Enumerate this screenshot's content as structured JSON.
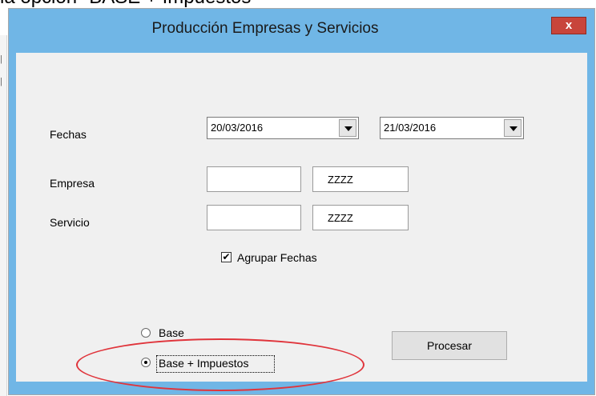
{
  "header": {
    "caption": "la opción \"BASE + Impuestos\""
  },
  "window": {
    "title": "Producción Empresas y Servicios",
    "close_label": "x"
  },
  "form": {
    "fechas_label": "Fechas",
    "fecha_desde": "20/03/2016",
    "fecha_hasta": "21/03/2016",
    "empresa_label": "Empresa",
    "empresa_from": "",
    "empresa_to": "ZZZZ",
    "servicio_label": "Servicio",
    "servicio_from": "",
    "servicio_to": "ZZZZ",
    "agrupar_label": "Agrupar Fechas",
    "agrupar_checked": true,
    "radio_base_label": "Base",
    "radio_base_impuestos_label": "Base + Impuestos",
    "radio_selected": "base_impuestos",
    "procesar_label": "Procesar"
  },
  "colors": {
    "titlebar": "#70b6e6",
    "close_button": "#c8453b",
    "highlight_ellipse": "#e0343b",
    "client_bg": "#f0f0f0"
  }
}
